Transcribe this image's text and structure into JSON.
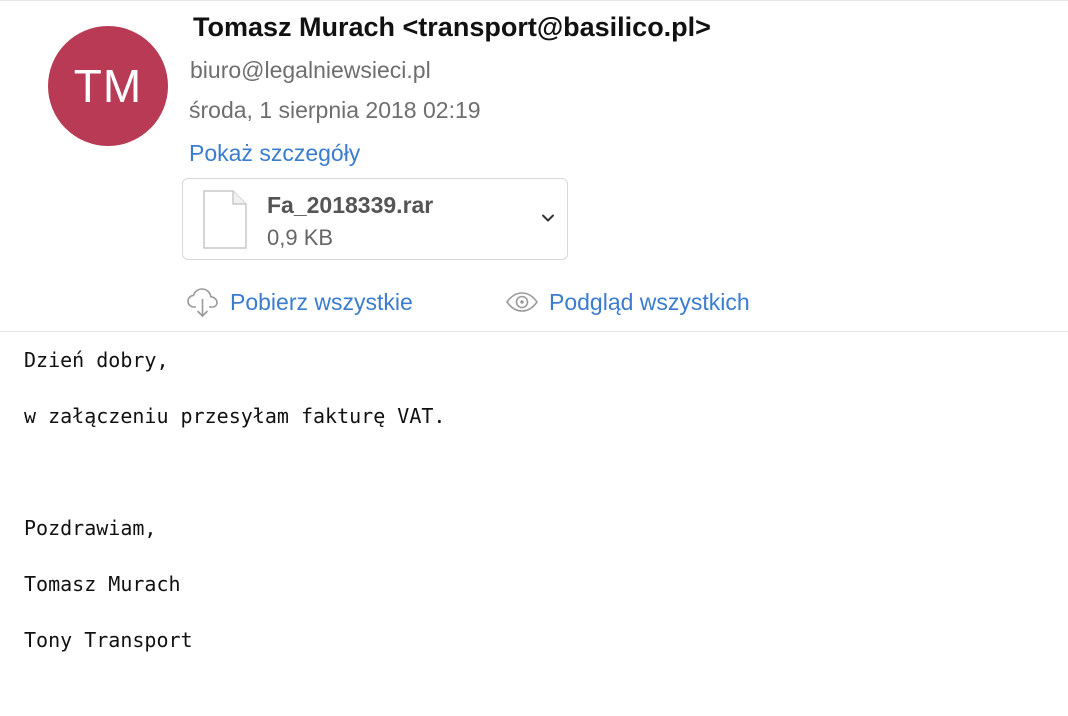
{
  "header": {
    "avatar_initials": "TM",
    "sender": "Tomasz Murach <transport@basilico.pl>",
    "recipient": "biuro@legalniewsieci.pl",
    "date": "środa, 1 sierpnia 2018 02:19",
    "details_link": "Pokaż szczegóły"
  },
  "attachment": {
    "name": "Fa_2018339.rar",
    "size": "0,9 KB"
  },
  "actions": {
    "download_all": "Pobierz wszystkie",
    "preview_all": "Podgląd wszystkich"
  },
  "body": {
    "lines": [
      "Dzień dobry,",
      "w załączeniu przesyłam fakturę VAT.",
      "Pozdrawiam,",
      "Tomasz Murach",
      "Tony Transport"
    ]
  },
  "colors": {
    "avatar": "#b83a55",
    "link": "#3a7ccf"
  },
  "icons": {
    "file": "document-icon",
    "chevron": "chevron-down-icon",
    "download": "cloud-download-icon",
    "preview": "eye-icon"
  }
}
